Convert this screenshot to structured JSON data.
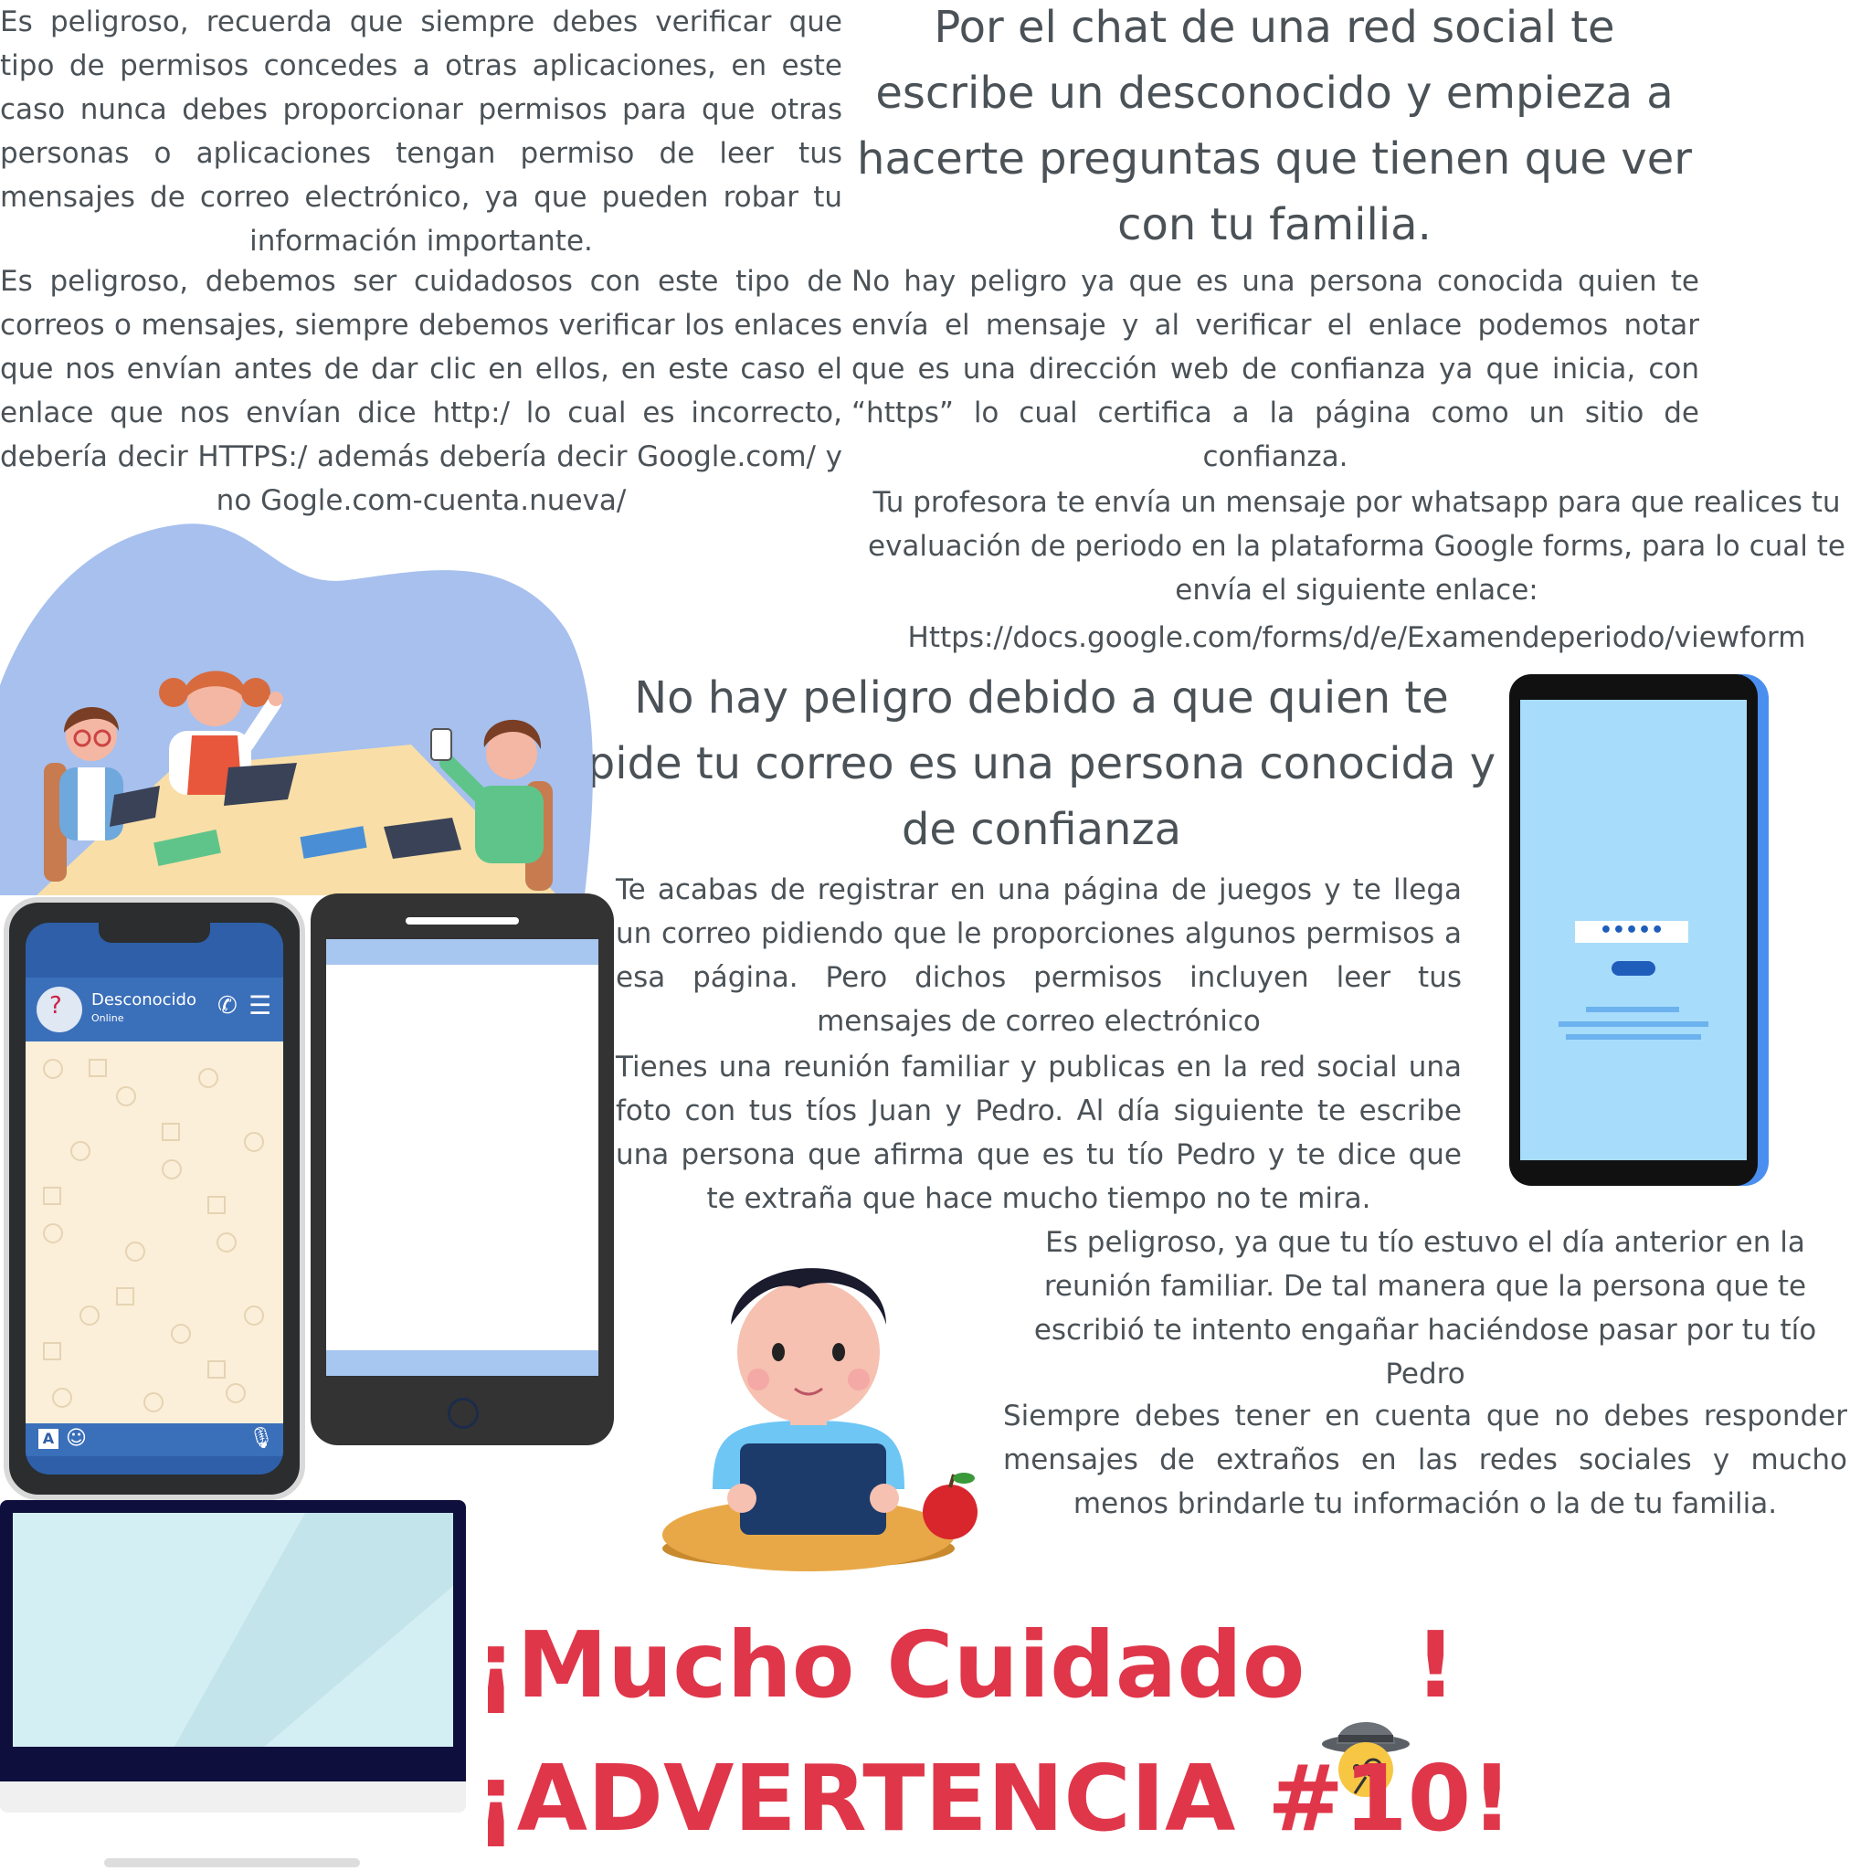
{
  "texts": {
    "permisos_respuesta": "Es peligroso, recuerda que siempre debes verificar que tipo de permisos concedes a otras aplicaciones, en este caso nunca debes proporcionar permisos para que otras personas o aplicaciones tengan permiso de leer tus mensajes de correo electrónico, ya que pueden robar tu información importante.",
    "enlace_respuesta": "Es peligroso, debemos ser cuidadosos con este tipo de correos o mensajes, siempre debemos verificar los enlaces que nos envían antes de dar clic en ellos, en este caso el enlace que nos envían dice http:/ lo cual es incorrecto, debería decir HTTPS:/  además debería decir Google.com/ y no Gogle.com-cuenta.nueva/",
    "chat_pregunta": "Por el chat de una red social te escribe un desconocido y empieza a hacerte preguntas que tienen que ver con tu familia.",
    "profesora_respuesta": "No hay peligro ya que es una persona conocida quien te envía el mensaje y al verificar el enlace podemos notar que es una dirección web de confianza ya que inicia, con “https” lo cual certifica a la página como un sitio de confianza.",
    "profesora_pregunta": "Tu profesora te envía un mensaje por whatsapp para que realices tu evaluación de periodo en la plataforma Google forms, para lo cual te envía el siguiente enlace:",
    "profesora_enlace": "Https://docs.google.com/forms/d/e/Examendeperiodo/viewform",
    "correo_respuesta": "No hay peligro debido a que quien te pide tu correo es una persona conocida y de confianza",
    "juegos_pregunta": "Te acabas de registrar en una página de juegos y te llega un correo pidiendo que le proporciones algunos permisos a esa página. Pero dichos permisos incluyen leer tus mensajes de correo electrónico",
    "reunion_pregunta": "Tienes una reunión familiar y publicas en la red social una foto con tus tíos Juan y Pedro. Al día siguiente te escribe una persona que afirma que es tu tío Pedro y te dice que te extraña que hace mucho tiempo no te mira.",
    "tio_respuesta": "Es peligroso, ya que tu tío estuvo el día anterior en la reunión familiar. De tal manera que la persona que te escribió te intento engañar haciéndose pasar por tu tío Pedro",
    "chat_respuesta": "Siempre debes tener en cuenta que no debes responder mensajes de extraños en las redes sociales y mucho menos brindarle tu información o la de tu familia."
  },
  "phone_chat": {
    "contact_name": "Desconocido",
    "contact_status": "Online"
  },
  "login_phone": {
    "password_mask": "•••••"
  },
  "banner": {
    "title": "¡Mucho Cuidado",
    "title_end": "!",
    "subtitle": "¡ADVERTENCIA #10!"
  },
  "icons": {
    "detective": "detective-icon",
    "call": "phone-icon",
    "menu": "menu-icon",
    "keyboard": "keyboard-icon",
    "emoji": "emoji-icon",
    "mic": "microphone-icon"
  },
  "colors": {
    "text": "#4b5257",
    "warning": "#e0364a",
    "blob": "#a7c0ee",
    "chat_header": "#2e5fa8",
    "login_screen": "#a8dcfb"
  }
}
